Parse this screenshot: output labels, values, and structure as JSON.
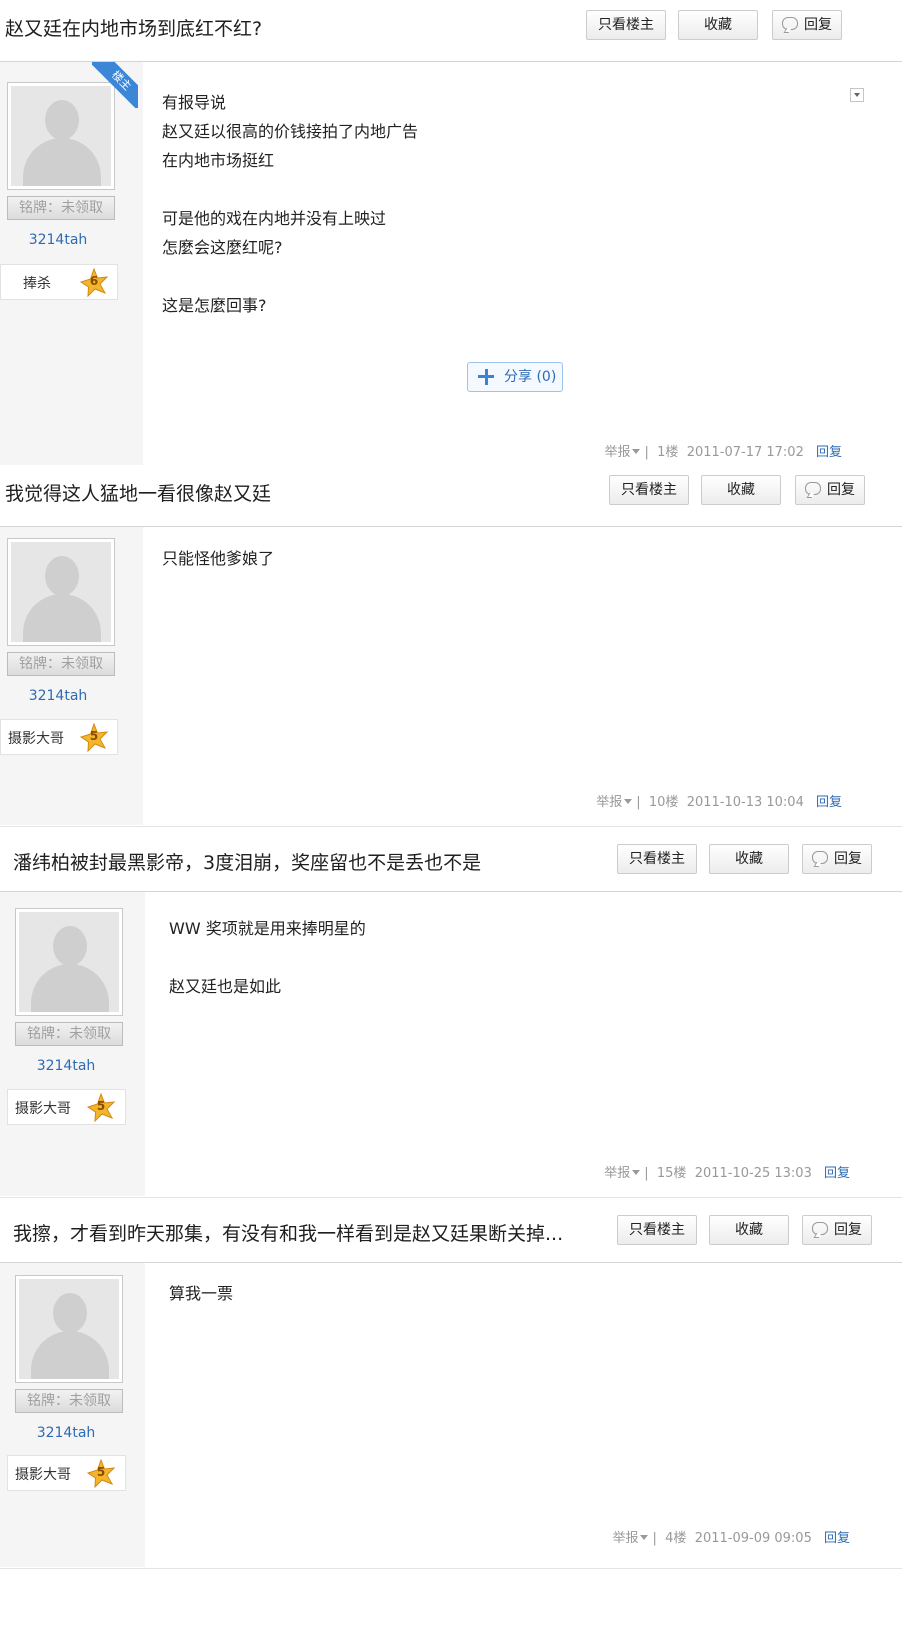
{
  "common": {
    "only_op_label": "只看楼主",
    "favorite_label": "收藏",
    "reply_label": "回复",
    "medal_label": "铭牌：未领取",
    "report_label": "举报",
    "footer_sep": "|",
    "footer_reply": "回复",
    "op_badge": "楼主"
  },
  "threads": [
    {
      "title": "赵又廷在内地市场到底红不红?",
      "username": "3214tah",
      "badge_name": "捧杀",
      "badge_level": "6",
      "lines": [
        "有报导说",
        "赵又廷以很高的价钱接拍了内地广告",
        "在内地市场挺红",
        "",
        "可是他的戏在内地并没有上映过",
        "怎麼会这麼红呢?",
        "",
        "这是怎麼回事?"
      ],
      "share_label": "分享",
      "share_count": "(0)",
      "floor": "1楼",
      "time": "2011-07-17 17:02"
    },
    {
      "title": "我觉得这人猛地一看很像赵又廷",
      "username": "3214tah",
      "badge_name": "摄影大哥",
      "badge_level": "5",
      "lines": [
        "只能怪他爹娘了"
      ],
      "floor": "10楼",
      "time": "2011-10-13 10:04"
    },
    {
      "title": "潘纬柏被封最黑影帝，3度泪崩，奖座留也不是丢也不是",
      "username": "3214tah",
      "badge_name": "摄影大哥",
      "badge_level": "5",
      "lines": [
        "WW 奖项就是用来捧明星的",
        "",
        "赵又廷也是如此"
      ],
      "floor": "15楼",
      "time": "2011-10-25 13:03"
    },
    {
      "title": "我擦，才看到昨天那集，有没有和我一样看到是赵又廷果断关掉...",
      "username": "3214tah",
      "badge_name": "摄影大哥",
      "badge_level": "5",
      "lines": [
        "算我一票"
      ],
      "floor": "4楼",
      "time": "2011-09-09 09:05"
    }
  ]
}
